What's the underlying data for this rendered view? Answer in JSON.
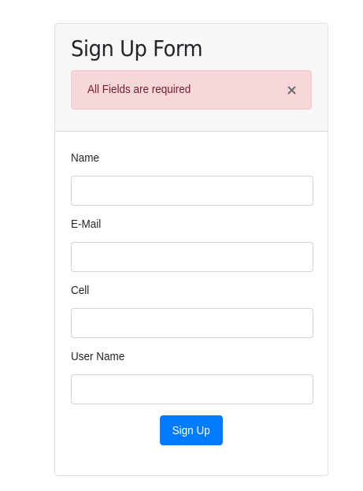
{
  "form": {
    "title": "Sign Up Form",
    "alert": {
      "message": "All Fields are required",
      "close_icon": "close-icon",
      "color": "#721c24",
      "background": "#f8d7da"
    },
    "fields": [
      {
        "label": "Name",
        "value": "",
        "placeholder": ""
      },
      {
        "label": "E-Mail",
        "value": "",
        "placeholder": ""
      },
      {
        "label": "Cell",
        "value": "",
        "placeholder": ""
      },
      {
        "label": "User Name",
        "value": "",
        "placeholder": ""
      }
    ],
    "submit_label": "Sign Up",
    "accent_color": "#007bff"
  }
}
